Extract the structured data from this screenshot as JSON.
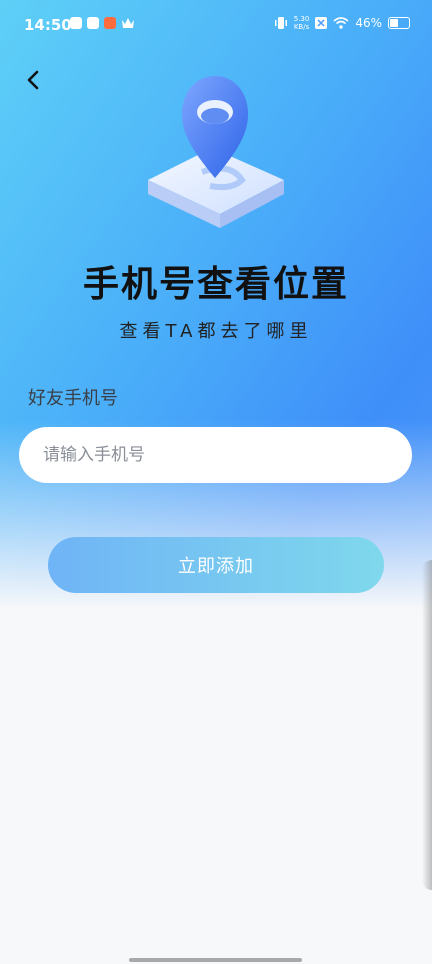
{
  "status_bar": {
    "time": "14:50",
    "net_speed_value": "5.30",
    "net_speed_unit": "KB/s",
    "battery": "46%"
  },
  "header": {
    "title": "手机号查看位置",
    "subtitle": "查看TA都去了哪里"
  },
  "form": {
    "label": "好友手机号",
    "phone_placeholder": "请输入手机号",
    "phone_value": "",
    "submit_label": "立即添加"
  },
  "colors": {
    "accent": "#3f8ff9",
    "button_start": "#6fb4f6",
    "button_end": "#7fd8ec"
  },
  "icons": [
    "back-arrow-icon",
    "location-pin-icon",
    "signal-icon",
    "wifi-icon",
    "battery-icon"
  ]
}
